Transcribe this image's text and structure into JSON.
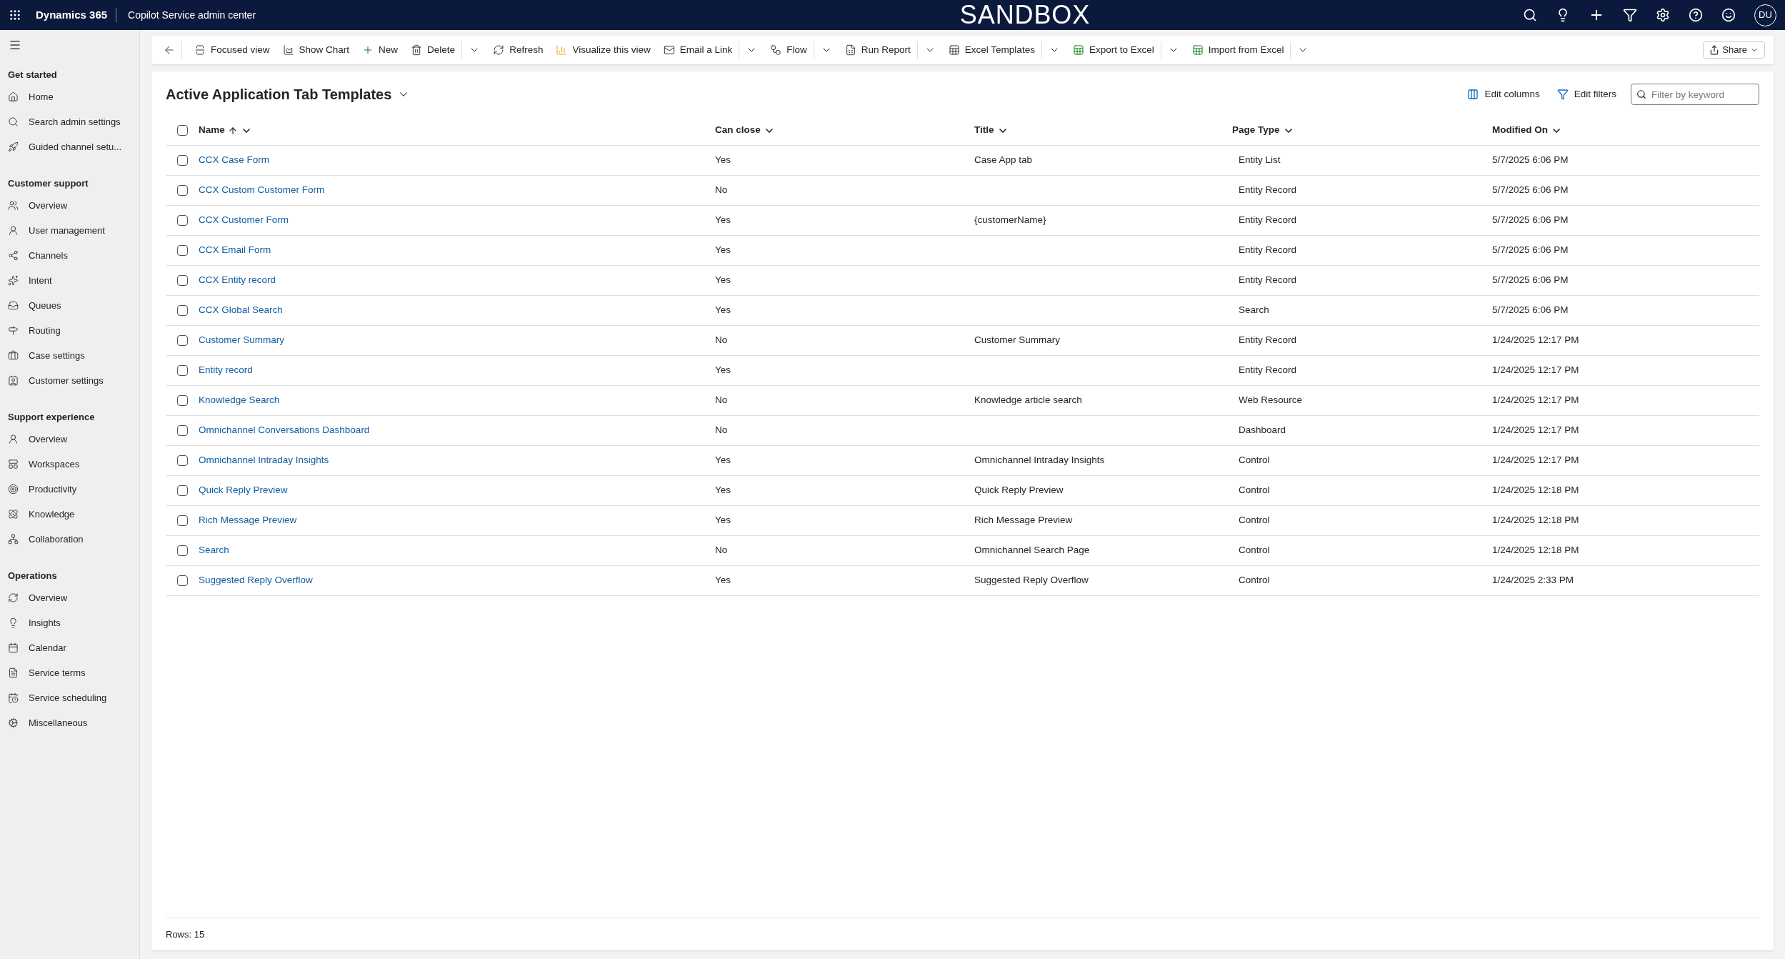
{
  "header": {
    "app": "Dynamics 365",
    "area": "Copilot Service admin center",
    "environment": "SANDBOX",
    "avatar": "DU"
  },
  "sidebar": {
    "sections": [
      {
        "title": "Get started",
        "items": [
          "Home",
          "Search admin settings",
          "Guided channel setu..."
        ]
      },
      {
        "title": "Customer support",
        "items": [
          "Overview",
          "User management",
          "Channels",
          "Intent",
          "Queues",
          "Routing",
          "Case settings",
          "Customer settings"
        ]
      },
      {
        "title": "Support experience",
        "items": [
          "Overview",
          "Workspaces",
          "Productivity",
          "Knowledge",
          "Collaboration"
        ]
      },
      {
        "title": "Operations",
        "items": [
          "Overview",
          "Insights",
          "Calendar",
          "Service terms",
          "Service scheduling",
          "Miscellaneous"
        ]
      }
    ]
  },
  "toolbar": [
    {
      "label": "Focused view",
      "menu": false
    },
    {
      "label": "Show Chart",
      "menu": false
    },
    {
      "label": "New",
      "menu": false
    },
    {
      "label": "Delete",
      "menu": true
    },
    {
      "label": "Refresh",
      "menu": false
    },
    {
      "label": "Visualize this view",
      "menu": false
    },
    {
      "label": "Email a Link",
      "menu": true
    },
    {
      "label": "Flow",
      "menu": true
    },
    {
      "label": "Run Report",
      "menu": true
    },
    {
      "label": "Excel Templates",
      "menu": true
    },
    {
      "label": "Export to Excel",
      "menu": true
    },
    {
      "label": "Import from Excel",
      "menu": true
    }
  ],
  "share": "Share",
  "view": {
    "title": "Active Application Tab Templates",
    "edit_columns": "Edit columns",
    "edit_filters": "Edit filters",
    "filter_placeholder": "Filter by keyword"
  },
  "table": {
    "all_selected": false,
    "columns": [
      {
        "label": "Name",
        "sorted": true
      },
      {
        "label": "Can close",
        "sorted": false
      },
      {
        "label": "Title",
        "sorted": false
      },
      {
        "label": "Page Type",
        "sorted": false
      },
      {
        "label": "Modified On",
        "sorted": false
      }
    ],
    "rows": [
      {
        "selected": false,
        "cells": [
          "CCX Case Form",
          "Yes",
          "Case App tab",
          "Entity List",
          "5/7/2025 6:06 PM"
        ]
      },
      {
        "selected": false,
        "cells": [
          "CCX Custom Customer Form",
          "No",
          "",
          "Entity Record",
          "5/7/2025 6:06 PM"
        ]
      },
      {
        "selected": false,
        "cells": [
          "CCX Customer Form",
          "Yes",
          "{customerName}",
          "Entity Record",
          "5/7/2025 6:06 PM"
        ]
      },
      {
        "selected": false,
        "cells": [
          "CCX Email Form",
          "Yes",
          "",
          "Entity Record",
          "5/7/2025 6:06 PM"
        ]
      },
      {
        "selected": false,
        "cells": [
          "CCX Entity record",
          "Yes",
          "",
          "Entity Record",
          "5/7/2025 6:06 PM"
        ]
      },
      {
        "selected": false,
        "cells": [
          "CCX Global Search",
          "Yes",
          "",
          "Search",
          "5/7/2025 6:06 PM"
        ]
      },
      {
        "selected": false,
        "cells": [
          "Customer Summary",
          "No",
          "Customer Summary",
          "Entity Record",
          "1/24/2025 12:17 PM"
        ]
      },
      {
        "selected": false,
        "cells": [
          "Entity record",
          "Yes",
          "",
          "Entity Record",
          "1/24/2025 12:17 PM"
        ]
      },
      {
        "selected": false,
        "cells": [
          "Knowledge Search",
          "No",
          "Knowledge article search",
          "Web Resource",
          "1/24/2025 12:17 PM"
        ]
      },
      {
        "selected": false,
        "cells": [
          "Omnichannel Conversations Dashboard",
          "No",
          "",
          "Dashboard",
          "1/24/2025 12:17 PM"
        ]
      },
      {
        "selected": false,
        "cells": [
          "Omnichannel Intraday Insights",
          "Yes",
          "Omnichannel Intraday Insights",
          "Control",
          "1/24/2025 12:17 PM"
        ]
      },
      {
        "selected": false,
        "cells": [
          "Quick Reply Preview",
          "Yes",
          "Quick Reply Preview",
          "Control",
          "1/24/2025 12:18 PM"
        ]
      },
      {
        "selected": false,
        "cells": [
          "Rich Message Preview",
          "Yes",
          "Rich Message Preview",
          "Control",
          "1/24/2025 12:18 PM"
        ]
      },
      {
        "selected": false,
        "cells": [
          "Search",
          "No",
          "Omnichannel Search Page",
          "Control",
          "1/24/2025 12:18 PM"
        ]
      },
      {
        "selected": false,
        "cells": [
          "Suggested Reply Overflow",
          "Yes",
          "Suggested Reply Overflow",
          "Control",
          "1/24/2025 2:33 PM"
        ]
      }
    ]
  },
  "footer": "Rows: 15"
}
